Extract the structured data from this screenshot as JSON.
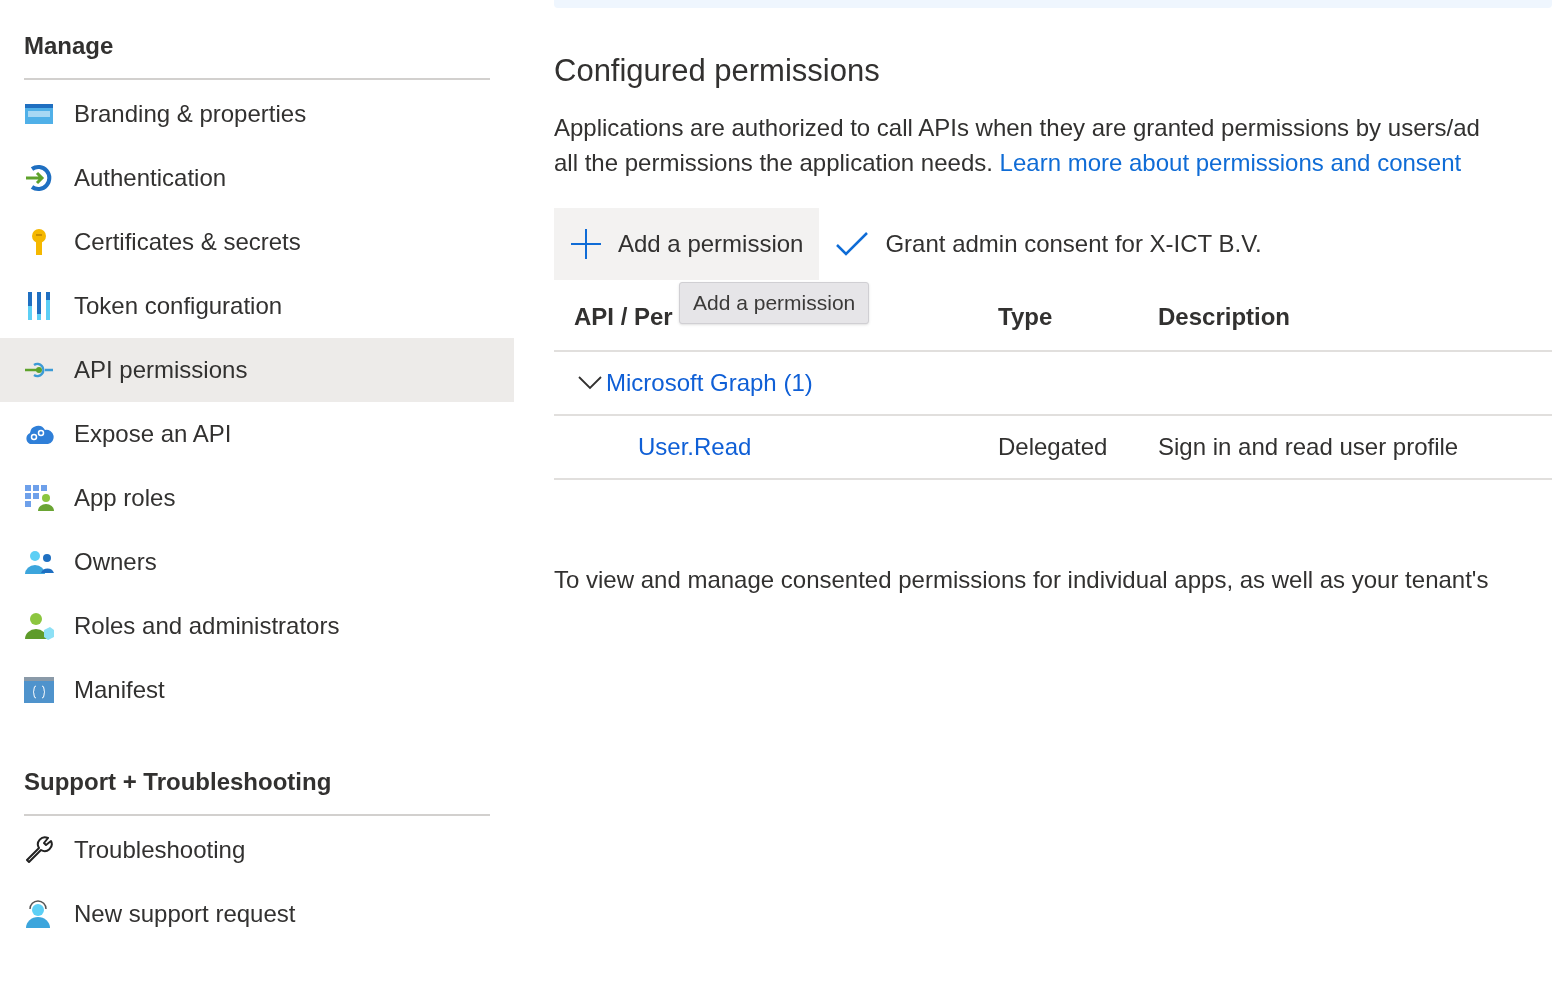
{
  "sidebar": {
    "sections": [
      {
        "title": "Manage",
        "items": [
          {
            "label": "Branding & properties",
            "kind": "branding",
            "selected": false
          },
          {
            "label": "Authentication",
            "kind": "authentication",
            "selected": false
          },
          {
            "label": "Certificates & secrets",
            "kind": "key",
            "selected": false
          },
          {
            "label": "Token configuration",
            "kind": "token",
            "selected": false
          },
          {
            "label": "API permissions",
            "kind": "api",
            "selected": true
          },
          {
            "label": "Expose an API",
            "kind": "cloud",
            "selected": false
          },
          {
            "label": "App roles",
            "kind": "roles",
            "selected": false
          },
          {
            "label": "Owners",
            "kind": "owners",
            "selected": false
          },
          {
            "label": "Roles and administrators",
            "kind": "admins",
            "selected": false
          },
          {
            "label": "Manifest",
            "kind": "manifest",
            "selected": false
          }
        ]
      },
      {
        "title": "Support + Troubleshooting",
        "items": [
          {
            "label": "Troubleshooting",
            "kind": "wrench",
            "selected": false
          },
          {
            "label": "New support request",
            "kind": "support",
            "selected": false
          }
        ]
      }
    ]
  },
  "main": {
    "title": "Configured permissions",
    "description_line1": "Applications are authorized to call APIs when they are granted permissions by users/ad",
    "description_line2": "all the permissions the application needs.",
    "learn_more_link": "Learn more about permissions and consent",
    "toolbar": [
      {
        "label": "Add a permission",
        "kind": "add"
      },
      {
        "label": "Grant admin consent for X-ICT B.V.",
        "kind": "grant"
      }
    ],
    "tooltip": "Add a permission",
    "table": {
      "columns": [
        "API / Per",
        "Type",
        "Description"
      ],
      "groups": [
        {
          "name": "Microsoft Graph (1)",
          "expanded": true,
          "rows": [
            {
              "name": "User.Read",
              "type": "Delegated",
              "description": "Sign in and read user profile"
            }
          ]
        }
      ]
    },
    "footer_text": "To view and manage consented permissions for individual apps, as well as your tenant's"
  }
}
